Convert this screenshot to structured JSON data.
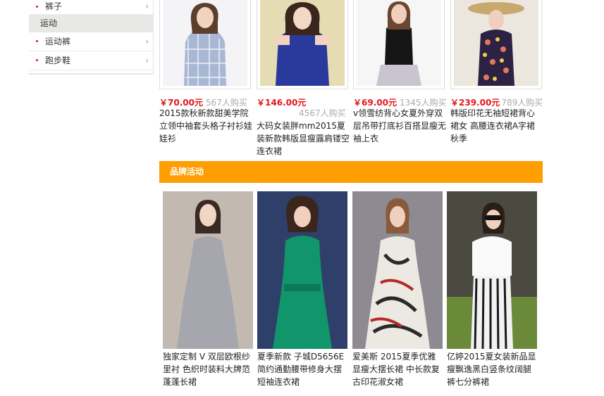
{
  "sidebar": {
    "items_top": [
      {
        "label": "裤子"
      }
    ],
    "section_header": "运动",
    "items": [
      {
        "label": "运动裤"
      },
      {
        "label": "跑步鞋"
      }
    ]
  },
  "products": [
    {
      "price": "￥70.00元",
      "sold": "567人购买",
      "title": "2015款秋新款甜美学院立领中袖套头格子衬衫娃娃衫"
    },
    {
      "price": "￥146.00元",
      "sold": "4567人购买",
      "title": "大码女装胖mm2015夏装新款韩版显瘦露肩镂空连衣裙"
    },
    {
      "price": "￥69.00元",
      "sold": "1345人购买",
      "title": "v领雪纺背心女夏外穿双层吊带打底衫百搭显瘦无袖上衣"
    },
    {
      "price": "￥239.00元",
      "sold": "789人购买",
      "title": "韩版印花无袖短裙背心裙女 高腰连衣裙A字裙秋季"
    }
  ],
  "banner": {
    "title": "品牌活动"
  },
  "brands": [
    {
      "title": "独家定制 V 双层欧根纱里衬 色织时装料大牌范蓬蓬长裙"
    },
    {
      "title": "夏季新款 子城D5656E简约通勤腰带修身大摆短袖连衣裙"
    },
    {
      "title": "爱美斯 2015夏季优雅显瘦大摆长裙 中长款复古印花淑女裙"
    },
    {
      "title": "亿婷2015夏女装新品显瘦飘逸黑白竖条纹阔腿裤七分裤裙"
    }
  ],
  "colors": {
    "accent": "#fe9e00",
    "price": "#e4161b"
  }
}
